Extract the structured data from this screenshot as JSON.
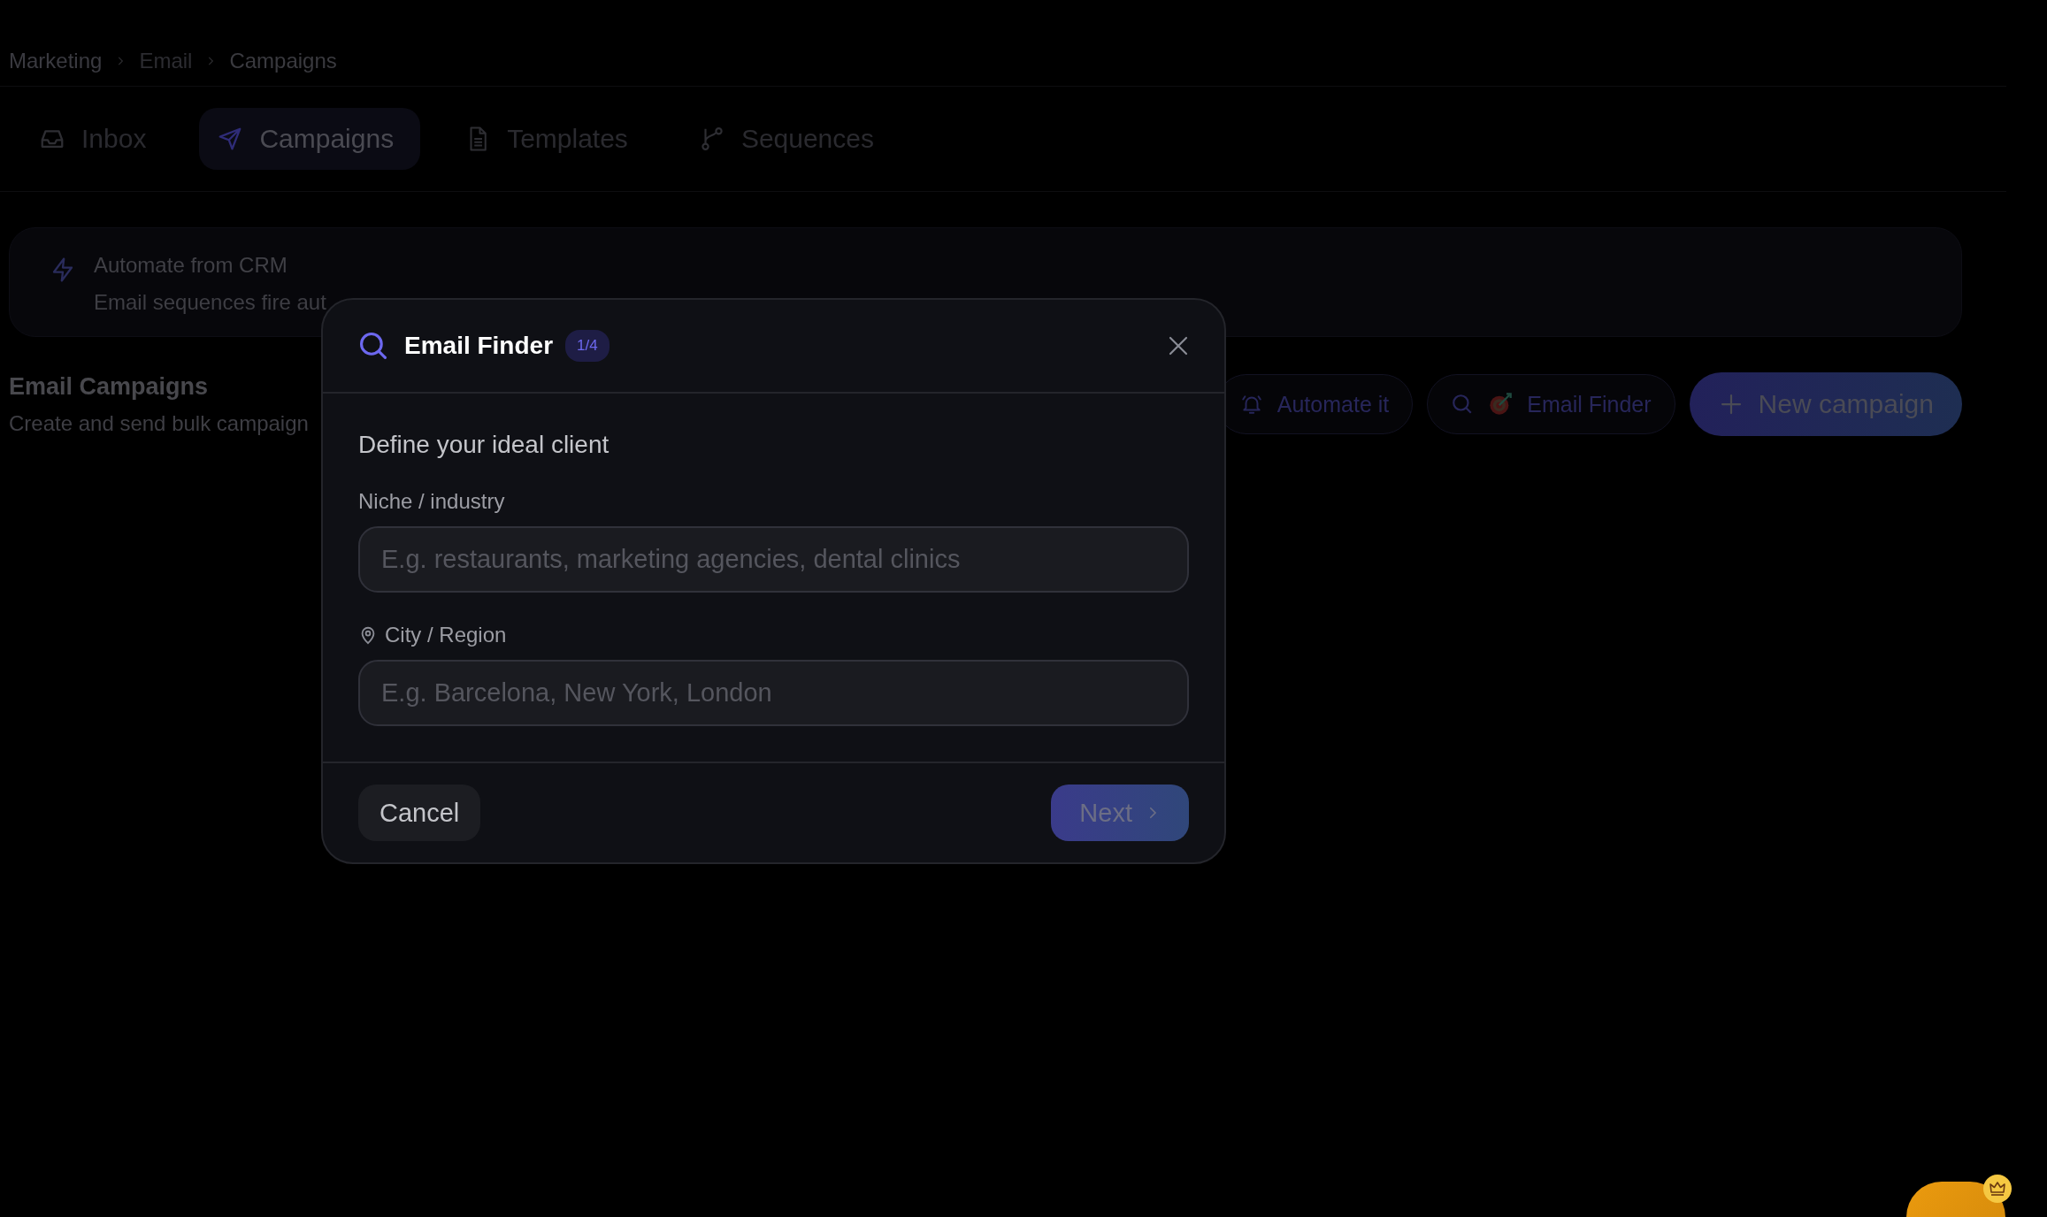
{
  "breadcrumb": [
    "Marketing",
    "Email",
    "Campaigns"
  ],
  "tabs": [
    {
      "label": "Inbox",
      "selected": false
    },
    {
      "label": "Campaigns",
      "selected": true
    },
    {
      "label": "Templates",
      "selected": false
    },
    {
      "label": "Sequences",
      "selected": false
    }
  ],
  "banner": {
    "title": "Automate from CRM",
    "description": "Email sequences fire aut"
  },
  "section": {
    "title": "Email Campaigns",
    "subtitle": "Create and send bulk campaign"
  },
  "actions": [
    {
      "kind": "outline",
      "label": "Automate it"
    },
    {
      "kind": "outline",
      "label": "Email Finder"
    },
    {
      "kind": "primary",
      "label": "New campaign"
    }
  ],
  "modal": {
    "title": "Email Finder",
    "step": "1/4",
    "heading": "Define your ideal client",
    "fields": [
      {
        "label": "Niche / industry",
        "placeholder": "E.g. restaurants, marketing agencies, dental clinics"
      },
      {
        "label": "City / Region",
        "placeholder": "E.g. Barcelona, New York, London"
      }
    ],
    "buttons": [
      {
        "kind": "secondary",
        "label": "Cancel"
      },
      {
        "kind": "primary",
        "label": "Next"
      }
    ]
  }
}
